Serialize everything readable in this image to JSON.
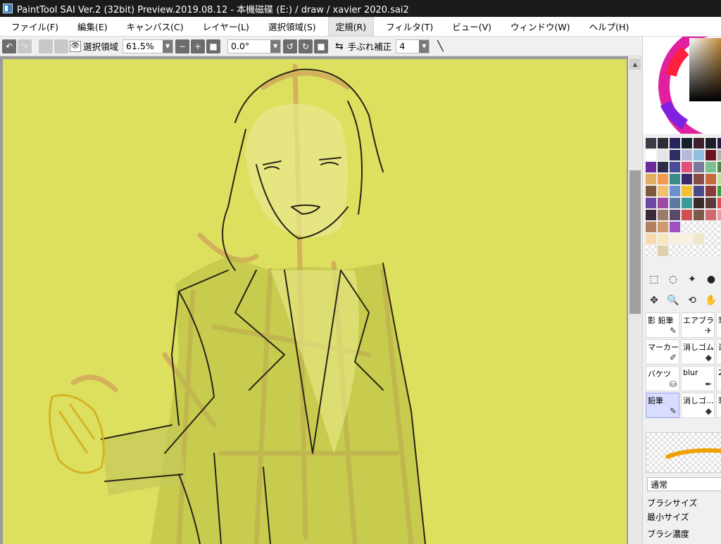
{
  "window": {
    "title": "PaintTool SAI Ver.2 (32bit) Preview.2019.08.12 - 本機磁碟 (E:) / draw / xavier 2020.sai2"
  },
  "menu": [
    {
      "label": "ファイル(F)"
    },
    {
      "label": "編集(E)"
    },
    {
      "label": "キャンバス(C)"
    },
    {
      "label": "レイヤー(L)"
    },
    {
      "label": "選択領域(S)"
    },
    {
      "label": "定規(R)"
    },
    {
      "label": "フィルタ(T)"
    },
    {
      "label": "ビュー(V)"
    },
    {
      "label": "ウィンドウ(W)"
    },
    {
      "label": "ヘルプ(H)"
    }
  ],
  "toolbar": {
    "selection_label": "選択領域",
    "zoom": "61.5%",
    "rotation": "0.0°",
    "stabilizer_label": "手ぶれ補正",
    "stabilizer_value": "4"
  },
  "swatch_colors": [
    "#3c3c46",
    "#2c2c38",
    "#26245a",
    "#142030",
    "#3c1e2c",
    "#1e1e28",
    "#2a1848",
    "#fff",
    "#e6e6e6",
    "#2b2d64",
    "#b8b8d8",
    "#90c0e0",
    "#6a1420",
    "#b0b0b0",
    "#6a2a9a",
    "#2e2e4a",
    "#4a4a9a",
    "#e0507a",
    "#7a7a9a",
    "#7ac090",
    "#4a8a4a",
    "#e0b060",
    "#f09a50",
    "#3c8a8a",
    "#3a2a6a",
    "#8a4a4a",
    "#c86a3a",
    "#c0e0a0",
    "#7a5a3a",
    "#f0c070",
    "#6a90d0",
    "#f0c030",
    "#4a4a8a",
    "#8a3a3a",
    "#3aa03a",
    "#6a4aa0",
    "#9a4aa0",
    "#5a7aa0",
    "#3a9a9a",
    "#3a2a2a",
    "#5a3a3a",
    "#e05050",
    "#3a2a3a",
    "#9a7a6a",
    "#5a4a6a",
    "#d05050",
    "#7a5a4a",
    "#d06a70",
    "#e8a0a0",
    "#b08060",
    "#d09a70",
    "#a050c0",
    "#chk",
    "#chk",
    "#chk",
    "#chk",
    "#f8d8b0",
    "#f8e8c0",
    "#f8f0d8",
    "#f8f0e0",
    "#f0e8c8",
    "#chk",
    "#chk",
    "#chk",
    "#e0d0b0",
    "#chk",
    "#chk",
    "#chk",
    "#chk",
    "#chk"
  ],
  "tools_icons": [
    "rect-select-icon",
    "lasso-icon",
    "magic-wand-icon",
    "shape-icon",
    "move-icon",
    "zoom-icon",
    "rotate-icon",
    "hand-icon"
  ],
  "brushes": [
    {
      "label": "影 鉛筆",
      "icon": "pencil-icon"
    },
    {
      "label": "エアブラシ",
      "icon": "airbrush-icon"
    },
    {
      "label": "筆",
      "icon": ""
    },
    {
      "label": "マーカー",
      "icon": "marker-icon"
    },
    {
      "label": "消しゴム",
      "icon": "eraser-icon"
    },
    {
      "label": "選",
      "icon": ""
    },
    {
      "label": "バケツ",
      "icon": "bucket-icon"
    },
    {
      "label": "blur",
      "icon": "blur-brush-icon"
    },
    {
      "label": "2",
      "icon": ""
    },
    {
      "label": "鉛筆",
      "icon": "pencil-icon",
      "selected": true
    },
    {
      "label": "消しゴ...",
      "icon": "eraser-icon"
    },
    {
      "label": "筆",
      "icon": ""
    }
  ],
  "brush_props": {
    "blend_mode": "通常",
    "size_label": "ブラシサイズ",
    "min_size_label": "最小サイズ",
    "density_label": "ブラシ濃度"
  },
  "colors": {
    "canvas_bg": "#dde05e",
    "titlebar": "#1b1b1b",
    "accent": "#f0a000"
  }
}
